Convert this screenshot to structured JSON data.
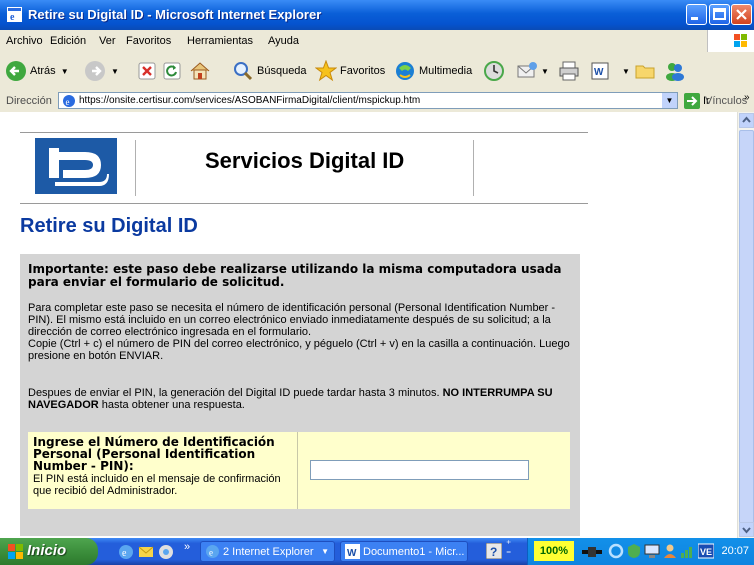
{
  "window": {
    "title": "Retire su Digital ID - Microsoft Internet Explorer"
  },
  "menu": [
    "Archivo",
    "Edición",
    "Ver",
    "Favoritos",
    "Herramientas",
    "Ayuda"
  ],
  "toolbar": {
    "back": "Atrás",
    "search": "Búsqueda",
    "favorites": "Favoritos",
    "media": "Multimedia"
  },
  "address": {
    "label": "Dirección",
    "url": "https://onsite.certisur.com/services/ASOBANFirmaDigital/client/mspickup.htm",
    "go": "Ir",
    "links": "Vínculos"
  },
  "page": {
    "site_title": "Servicios Digital ID",
    "heading": "Retire su Digital ID",
    "important": "Importante: este paso debe realizarse utilizando la misma computadora usada para enviar el formulario de solicitud.",
    "para1": "Para completar este paso se necesita el número de identificación personal (Personal Identification Number - PIN). El mismo está incluido en un correo electrónico enviado inmediatamente después de su solicitud; a la dirección de correo electrónico ingresada en el formulario.",
    "para1b": "Copie (Ctrl + c) el número de PIN del correo electrónico, y péguelo (Ctrl + v) en la casilla a continuación. Luego presione en botón ENVIAR.",
    "para2_a": "Despues de enviar el PIN, la generación del Digital ID puede tardar hasta 3 minutos. ",
    "para2_b": "NO INTERRUMPA SU NAVEGADOR",
    "para2_c": " hasta obtener una respuesta.",
    "pin_label": "Ingrese el Número de Identificación Personal (Personal Identification Number - PIN):",
    "pin_desc": "El PIN está incluido en el mensaje de confirmación que recibió del Administrador.",
    "pin_value": ""
  },
  "taskbar": {
    "start": "Inicio",
    "tasks": [
      "2 Internet Explorer",
      "Documento1 - Micr..."
    ],
    "zoom": "100%",
    "clock": "20:07"
  }
}
